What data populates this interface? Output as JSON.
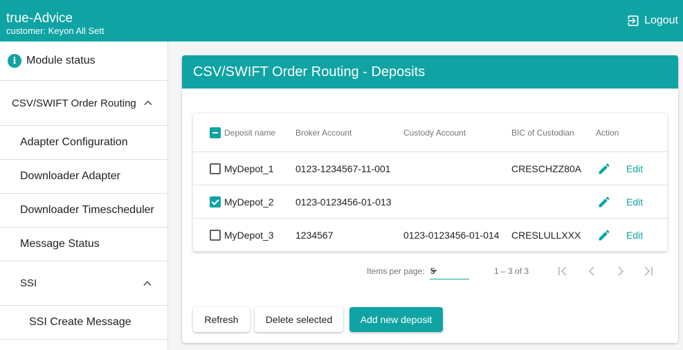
{
  "header": {
    "title": "true-Advice",
    "subtitle": "customer: Keyon All Sett",
    "logout_label": "Logout"
  },
  "sidebar": {
    "module_status": "Module status",
    "csv_group": "CSV/SWIFT Order Routing",
    "items": [
      "Adapter Configuration",
      "Downloader Adapter",
      "Downloader Timescheduler",
      "Message Status"
    ],
    "ssi_group": "SSI",
    "ssi_items": [
      "SSI Create Message"
    ]
  },
  "card": {
    "title": "CSV/SWIFT Order Routing - Deposits"
  },
  "table": {
    "columns": [
      "Deposit name",
      "Broker Account",
      "Custody Account",
      "BIC of Custodian",
      "Action"
    ],
    "rows": [
      {
        "name": "MyDepot_1",
        "broker": "0123-1234567-11-001",
        "custody": "",
        "bic": "CRESCHZZ80A",
        "action": "Edit",
        "checked": false
      },
      {
        "name": "MyDepot_2",
        "broker": "0123-0123456-01-013",
        "custody": "",
        "bic": "",
        "action": "Edit",
        "checked": true
      },
      {
        "name": "MyDepot_3",
        "broker": "1234567",
        "custody": "0123-0123456-01-014",
        "bic": "CRESLULLXXX",
        "action": "Edit",
        "checked": false
      }
    ]
  },
  "paginator": {
    "items_per_page_label": "Items per page:",
    "page_size": "5",
    "range": "1 – 3 of 3"
  },
  "buttons": {
    "refresh": "Refresh",
    "delete_selected": "Delete selected",
    "add_new": "Add new deposit"
  },
  "colors": {
    "primary": "#10a3a3"
  },
  "icons": {
    "logout": "logout-icon",
    "info": "info-icon",
    "chevron": "chevron-up-icon",
    "edit": "pencil-icon",
    "first": "first-page-icon",
    "prev": "chevron-left-icon",
    "next": "chevron-right-icon",
    "last": "last-page-icon"
  }
}
